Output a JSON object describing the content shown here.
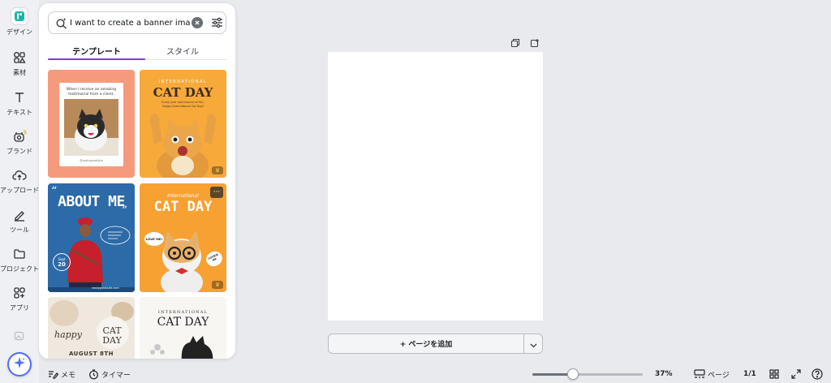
{
  "rail": {
    "items": [
      {
        "label": "デザイン"
      },
      {
        "label": "素材"
      },
      {
        "label": "テキスト"
      },
      {
        "label": "ブランド"
      },
      {
        "label": "アップロード"
      },
      {
        "label": "ツール"
      },
      {
        "label": "プロジェクト"
      },
      {
        "label": "アプリ"
      }
    ]
  },
  "panel": {
    "search": {
      "value": "I want to create a banner image"
    },
    "tabs": [
      {
        "label": "テンプレート",
        "active": true
      },
      {
        "label": "スタイル",
        "active": false
      }
    ],
    "templates": {
      "t1": {
        "caption": "When I receive an amazing testimonial from a client.",
        "handle": "@reallygreatsite"
      },
      "t2": {
        "kicker": "INTERNATIONAL",
        "title": "CAT DAY",
        "subtitle": "Every purr and pounce of fun. Happy International Cat Day!"
      },
      "t3": {
        "title": "ABOUT ME",
        "badge_top": "Sept",
        "badge_num": "20",
        "footer": "reallygreatsite.com"
      },
      "t4": {
        "kicker": "International",
        "title": "CAT DAY",
        "bubble_left": "LOVE ME!",
        "bubble_right": "COOKIE ME"
      },
      "t5": {
        "script": "happy",
        "title": "CAT DAY",
        "date": "AUGUST 8TH"
      },
      "t6": {
        "kicker": "INTERNATIONAL",
        "title": "CAT DAY"
      }
    }
  },
  "editor": {
    "add_page_label": "+ ページを追加"
  },
  "bottombar": {
    "notes_label": "メモ",
    "timer_label": "タイマー",
    "zoom": "37%",
    "zoom_value": 0.37,
    "pages_label": "ページ",
    "page_count": "1/1"
  },
  "colors": {
    "accent": "#7c3aed",
    "magic": "#4f6bff"
  }
}
